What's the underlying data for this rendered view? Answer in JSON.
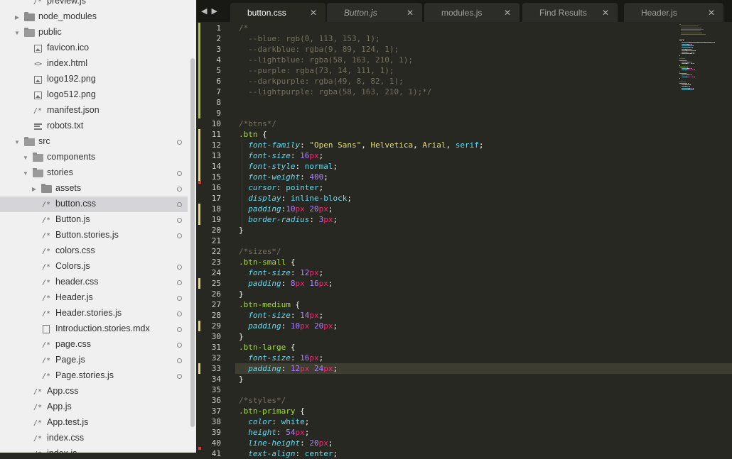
{
  "sidebar": {
    "items": [
      {
        "label": "preview.js",
        "depth": 2,
        "kind": "js",
        "twisty": "",
        "dot": false
      },
      {
        "label": "node_modules",
        "depth": 1,
        "kind": "folder",
        "twisty": "closed",
        "dot": false
      },
      {
        "label": "public",
        "depth": 1,
        "kind": "folder-open",
        "twisty": "open",
        "dot": false
      },
      {
        "label": "favicon.ico",
        "depth": 2,
        "kind": "image",
        "twisty": "",
        "dot": false
      },
      {
        "label": "index.html",
        "depth": 2,
        "kind": "code",
        "twisty": "",
        "dot": false
      },
      {
        "label": "logo192.png",
        "depth": 2,
        "kind": "image",
        "twisty": "",
        "dot": false
      },
      {
        "label": "logo512.png",
        "depth": 2,
        "kind": "image",
        "twisty": "",
        "dot": false
      },
      {
        "label": "manifest.json",
        "depth": 2,
        "kind": "comment",
        "twisty": "",
        "dot": false
      },
      {
        "label": "robots.txt",
        "depth": 2,
        "kind": "text",
        "twisty": "",
        "dot": false
      },
      {
        "label": "src",
        "depth": 1,
        "kind": "folder-open",
        "twisty": "open",
        "dot": true
      },
      {
        "label": "components",
        "depth": 2,
        "kind": "folder-open",
        "twisty": "open",
        "dot": false
      },
      {
        "label": "stories",
        "depth": 2,
        "kind": "folder-open",
        "twisty": "open",
        "dot": true
      },
      {
        "label": "assets",
        "depth": 3,
        "kind": "folder",
        "twisty": "closed",
        "dot": true
      },
      {
        "label": "button.css",
        "depth": 3,
        "kind": "comment",
        "twisty": "",
        "dot": true,
        "selected": true
      },
      {
        "label": "Button.js",
        "depth": 3,
        "kind": "comment",
        "twisty": "",
        "dot": true
      },
      {
        "label": "Button.stories.js",
        "depth": 3,
        "kind": "comment",
        "twisty": "",
        "dot": true
      },
      {
        "label": "colors.css",
        "depth": 3,
        "kind": "comment",
        "twisty": "",
        "dot": false
      },
      {
        "label": "Colors.js",
        "depth": 3,
        "kind": "comment",
        "twisty": "",
        "dot": true
      },
      {
        "label": "header.css",
        "depth": 3,
        "kind": "comment",
        "twisty": "",
        "dot": true
      },
      {
        "label": "Header.js",
        "depth": 3,
        "kind": "comment",
        "twisty": "",
        "dot": true
      },
      {
        "label": "Header.stories.js",
        "depth": 3,
        "kind": "comment",
        "twisty": "",
        "dot": true
      },
      {
        "label": "Introduction.stories.mdx",
        "depth": 3,
        "kind": "doc",
        "twisty": "",
        "dot": true
      },
      {
        "label": "page.css",
        "depth": 3,
        "kind": "comment",
        "twisty": "",
        "dot": true
      },
      {
        "label": "Page.js",
        "depth": 3,
        "kind": "comment",
        "twisty": "",
        "dot": true
      },
      {
        "label": "Page.stories.js",
        "depth": 3,
        "kind": "comment",
        "twisty": "",
        "dot": true
      },
      {
        "label": "App.css",
        "depth": 2,
        "kind": "comment",
        "twisty": "",
        "dot": false
      },
      {
        "label": "App.js",
        "depth": 2,
        "kind": "comment",
        "twisty": "",
        "dot": false
      },
      {
        "label": "App.test.js",
        "depth": 2,
        "kind": "comment",
        "twisty": "",
        "dot": false
      },
      {
        "label": "index.css",
        "depth": 2,
        "kind": "comment",
        "twisty": "",
        "dot": false
      },
      {
        "label": "index.js",
        "depth": 2,
        "kind": "comment",
        "twisty": "",
        "dot": false
      }
    ]
  },
  "tabs": [
    {
      "label": "button.css",
      "active": true,
      "italic": false
    },
    {
      "label": "Button.js",
      "active": false,
      "italic": true
    },
    {
      "label": "modules.js",
      "active": false,
      "italic": false
    },
    {
      "label": "Find Results",
      "active": false,
      "italic": false
    },
    {
      "label": "Header.js",
      "active": false,
      "italic": false
    }
  ],
  "editor": {
    "current_line": 33,
    "lines": [
      [
        [
          "/*",
          "c-cmt"
        ]
      ],
      [
        [
          "  --blue: rgb(0, 113, 153, 1);",
          "c-cmt"
        ]
      ],
      [
        [
          "  --darkblue: rgba(9, 89, 124, 1);",
          "c-cmt"
        ]
      ],
      [
        [
          "  --lightblue: rgba(58, 163, 210, 1);",
          "c-cmt"
        ]
      ],
      [
        [
          "  --purple: rgba(73, 14, 111, 1);",
          "c-cmt"
        ]
      ],
      [
        [
          "  --darkpurple: rgba(49, 8, 82, 1);",
          "c-cmt"
        ]
      ],
      [
        [
          "  --lightpurple: rgba(58, 163, 210, 1);*/",
          "c-cmt"
        ]
      ],
      [],
      [],
      [
        [
          "/*btns*/",
          "c-cmt"
        ]
      ],
      [
        [
          ".btn",
          "c-sel"
        ],
        [
          " {",
          "c-pun"
        ]
      ],
      [
        [
          "  ",
          "c-pun"
        ],
        [
          "font-family",
          "c-prop"
        ],
        [
          ": ",
          "c-pun"
        ],
        [
          "\"Open Sans\"",
          "c-str"
        ],
        [
          ", ",
          "c-pun"
        ],
        [
          "Helvetica",
          "c-str"
        ],
        [
          ", ",
          "c-pun"
        ],
        [
          "Arial",
          "c-str"
        ],
        [
          ", ",
          "c-pun"
        ],
        [
          "serif",
          "c-val"
        ],
        [
          ";",
          "c-pun"
        ]
      ],
      [
        [
          "  ",
          "c-pun"
        ],
        [
          "font-size",
          "c-prop"
        ],
        [
          ": ",
          "c-pun"
        ],
        [
          "16",
          "c-num"
        ],
        [
          "px",
          "c-unit"
        ],
        [
          ";",
          "c-pun"
        ]
      ],
      [
        [
          "  ",
          "c-pun"
        ],
        [
          "font-style",
          "c-prop"
        ],
        [
          ": ",
          "c-pun"
        ],
        [
          "normal",
          "c-val"
        ],
        [
          ";",
          "c-pun"
        ]
      ],
      [
        [
          "  ",
          "c-pun"
        ],
        [
          "font-weight",
          "c-prop"
        ],
        [
          ": ",
          "c-pun"
        ],
        [
          "400",
          "c-num"
        ],
        [
          ";",
          "c-pun"
        ]
      ],
      [
        [
          "  ",
          "c-pun"
        ],
        [
          "cursor",
          "c-prop"
        ],
        [
          ": ",
          "c-pun"
        ],
        [
          "pointer",
          "c-val"
        ],
        [
          ";",
          "c-pun"
        ]
      ],
      [
        [
          "  ",
          "c-pun"
        ],
        [
          "display",
          "c-prop"
        ],
        [
          ": ",
          "c-pun"
        ],
        [
          "inline-block",
          "c-val"
        ],
        [
          ";",
          "c-pun"
        ]
      ],
      [
        [
          "  ",
          "c-pun"
        ],
        [
          "padding",
          "c-prop"
        ],
        [
          ":",
          "c-pun"
        ],
        [
          "10",
          "c-num"
        ],
        [
          "px",
          "c-unit"
        ],
        [
          " ",
          "c-pun"
        ],
        [
          "20",
          "c-num"
        ],
        [
          "px",
          "c-unit"
        ],
        [
          ";",
          "c-pun"
        ]
      ],
      [
        [
          "  ",
          "c-pun"
        ],
        [
          "border-radius",
          "c-prop"
        ],
        [
          ": ",
          "c-pun"
        ],
        [
          "3",
          "c-num"
        ],
        [
          "px",
          "c-unit"
        ],
        [
          ";",
          "c-pun"
        ]
      ],
      [
        [
          "}",
          "c-pun"
        ]
      ],
      [],
      [
        [
          "/*sizes*/",
          "c-cmt"
        ]
      ],
      [
        [
          ".btn-small",
          "c-sel"
        ],
        [
          " {",
          "c-pun"
        ]
      ],
      [
        [
          "  ",
          "c-pun"
        ],
        [
          "font-size",
          "c-prop"
        ],
        [
          ": ",
          "c-pun"
        ],
        [
          "12",
          "c-num"
        ],
        [
          "px",
          "c-unit"
        ],
        [
          ";",
          "c-pun"
        ]
      ],
      [
        [
          "  ",
          "c-pun"
        ],
        [
          "padding",
          "c-prop"
        ],
        [
          ": ",
          "c-pun"
        ],
        [
          "8",
          "c-num"
        ],
        [
          "px",
          "c-unit"
        ],
        [
          " ",
          "c-pun"
        ],
        [
          "16",
          "c-num"
        ],
        [
          "px",
          "c-unit"
        ],
        [
          ";",
          "c-pun"
        ]
      ],
      [
        [
          "}",
          "c-pun"
        ]
      ],
      [
        [
          ".btn-medium",
          "c-sel"
        ],
        [
          " {",
          "c-pun"
        ]
      ],
      [
        [
          "  ",
          "c-pun"
        ],
        [
          "font-size",
          "c-prop"
        ],
        [
          ": ",
          "c-pun"
        ],
        [
          "14",
          "c-num"
        ],
        [
          "px",
          "c-unit"
        ],
        [
          ";",
          "c-pun"
        ]
      ],
      [
        [
          "  ",
          "c-pun"
        ],
        [
          "padding",
          "c-prop"
        ],
        [
          ": ",
          "c-pun"
        ],
        [
          "10",
          "c-num"
        ],
        [
          "px",
          "c-unit"
        ],
        [
          " ",
          "c-pun"
        ],
        [
          "20",
          "c-num"
        ],
        [
          "px",
          "c-unit"
        ],
        [
          ";",
          "c-pun"
        ]
      ],
      [
        [
          "}",
          "c-pun"
        ]
      ],
      [
        [
          ".btn-large",
          "c-sel"
        ],
        [
          " {",
          "c-pun"
        ]
      ],
      [
        [
          "  ",
          "c-pun"
        ],
        [
          "font-size",
          "c-prop"
        ],
        [
          ": ",
          "c-pun"
        ],
        [
          "16",
          "c-num"
        ],
        [
          "px",
          "c-unit"
        ],
        [
          ";",
          "c-pun"
        ]
      ],
      [
        [
          "  ",
          "c-pun"
        ],
        [
          "padding",
          "c-prop"
        ],
        [
          ": ",
          "c-pun"
        ],
        [
          "12",
          "c-num"
        ],
        [
          "px",
          "c-unit"
        ],
        [
          " ",
          "c-pun"
        ],
        [
          "24",
          "c-num"
        ],
        [
          "px",
          "c-unit"
        ],
        [
          ";",
          "c-pun"
        ]
      ],
      [
        [
          "}",
          "c-pun"
        ]
      ],
      [],
      [
        [
          "/*styles*/",
          "c-cmt"
        ]
      ],
      [
        [
          ".btn-primary",
          "c-sel"
        ],
        [
          " {",
          "c-pun"
        ]
      ],
      [
        [
          "  ",
          "c-pun"
        ],
        [
          "color",
          "c-prop"
        ],
        [
          ": ",
          "c-pun"
        ],
        [
          "white",
          "c-val"
        ],
        [
          ";",
          "c-pun"
        ]
      ],
      [
        [
          "  ",
          "c-pun"
        ],
        [
          "height",
          "c-prop"
        ],
        [
          ": ",
          "c-pun"
        ],
        [
          "54",
          "c-num"
        ],
        [
          "px",
          "c-unit"
        ],
        [
          ";",
          "c-pun"
        ]
      ],
      [
        [
          "  ",
          "c-pun"
        ],
        [
          "line-height",
          "c-prop"
        ],
        [
          ": ",
          "c-pun"
        ],
        [
          "20",
          "c-num"
        ],
        [
          "px",
          "c-unit"
        ],
        [
          ";",
          "c-pun"
        ]
      ],
      [
        [
          "  ",
          "c-pun"
        ],
        [
          "text-align",
          "c-prop"
        ],
        [
          ": ",
          "c-pun"
        ],
        [
          "center",
          "c-val"
        ],
        [
          ";",
          "c-pun"
        ]
      ]
    ],
    "git_marks": [
      {
        "from": 1,
        "to": 9,
        "type": "add"
      },
      {
        "from": 11,
        "to": 15,
        "type": "mod"
      },
      {
        "from": 16,
        "to": 16,
        "type": "del"
      },
      {
        "from": 18,
        "to": 19,
        "type": "mod"
      },
      {
        "from": 25,
        "to": 25,
        "type": "mod"
      },
      {
        "from": 29,
        "to": 29,
        "type": "mod"
      },
      {
        "from": 33,
        "to": 33,
        "type": "mod"
      },
      {
        "from": 41,
        "to": 41,
        "type": "del"
      }
    ]
  },
  "colors": {
    "editor_bg": "#272822",
    "sidebar_bg": "#f0f0f0",
    "comment": "#75715e",
    "selector": "#a6e22e",
    "property": "#66d9ef",
    "number": "#ae81ff",
    "unit": "#f92672",
    "string": "#e6db74"
  }
}
